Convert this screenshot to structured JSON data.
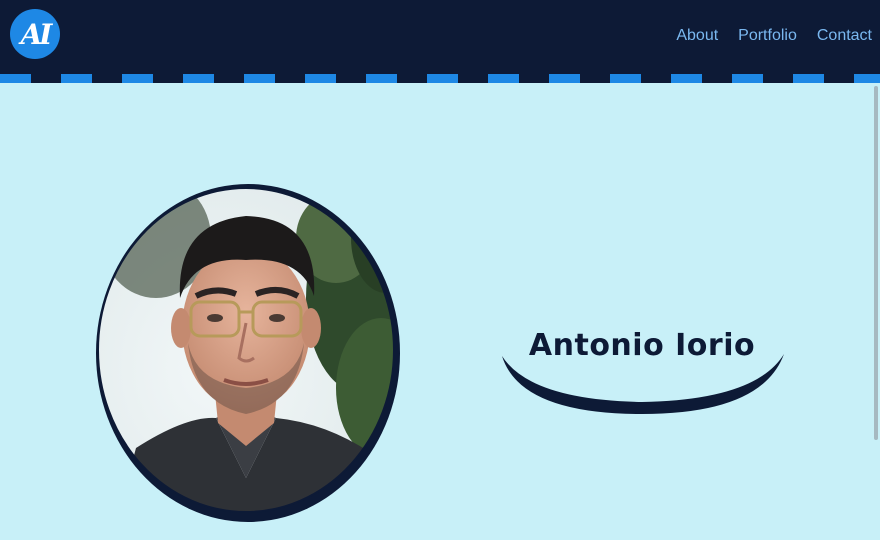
{
  "header": {
    "logo_text": "AI",
    "nav": [
      {
        "label": "About"
      },
      {
        "label": "Portfolio"
      },
      {
        "label": "Contact"
      }
    ]
  },
  "hero": {
    "name": "Antonio Iorio"
  },
  "colors": {
    "navbar": "#0d1a36",
    "accent": "#1e88e5",
    "page_bg": "#c8f0f8",
    "nav_text": "#7ab8f0"
  }
}
